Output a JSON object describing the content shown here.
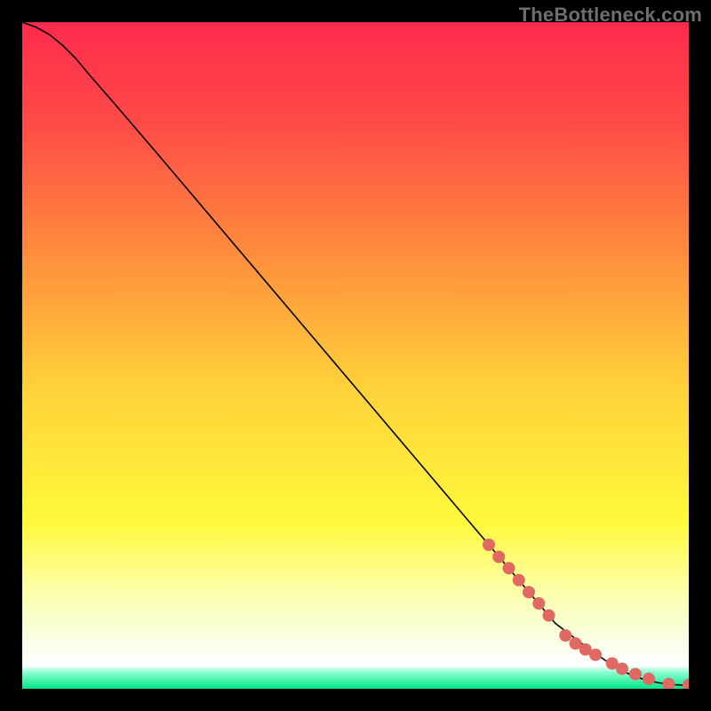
{
  "watermark": "TheBottleneck.com",
  "chart_data": {
    "type": "line",
    "title": "",
    "xlabel": "",
    "ylabel": "",
    "xlim": [
      0,
      100
    ],
    "ylim": [
      0,
      100
    ],
    "grid": false,
    "legend": false,
    "background_gradient": {
      "stops": [
        {
          "offset": 0.0,
          "color": "#ff2b4d"
        },
        {
          "offset": 0.15,
          "color": "#ff4a47"
        },
        {
          "offset": 0.35,
          "color": "#ff8e3d"
        },
        {
          "offset": 0.55,
          "color": "#ffd23a"
        },
        {
          "offset": 0.75,
          "color": "#fff93b"
        },
        {
          "offset": 0.85,
          "color": "#fdffa6"
        },
        {
          "offset": 0.92,
          "color": "#f7ffe0"
        },
        {
          "offset": 0.965,
          "color": "#ffffff"
        },
        {
          "offset": 0.975,
          "color": "#8dffd1"
        },
        {
          "offset": 1.0,
          "color": "#00e587"
        }
      ]
    },
    "series": [
      {
        "name": "curve",
        "type": "line",
        "color": "#000000",
        "x": [
          0,
          2,
          4,
          6,
          8,
          10,
          14,
          20,
          30,
          40,
          50,
          60,
          70,
          80,
          85,
          88,
          90,
          92,
          94,
          95.5,
          97,
          98,
          99,
          100
        ],
        "y": [
          100,
          99.3,
          98.2,
          96.6,
          94.6,
          92.2,
          87.6,
          80.6,
          68.8,
          57.0,
          45.2,
          33.4,
          21.6,
          9.8,
          6.0,
          3.9,
          2.7,
          1.8,
          1.2,
          0.9,
          0.7,
          0.6,
          0.55,
          0.55
        ]
      },
      {
        "name": "highlighted-points",
        "type": "scatter",
        "color": "#e06a63",
        "radius": 7,
        "x": [
          70.0,
          71.5,
          73.0,
          74.5,
          76.0,
          77.5,
          79.0,
          81.5,
          83.0,
          84.5,
          86.0,
          88.5,
          90.0,
          92.0,
          94.0,
          97.0,
          100.0
        ],
        "y": [
          21.6,
          19.8,
          18.1,
          16.3,
          14.5,
          12.8,
          11.0,
          8.0,
          6.8,
          5.9,
          5.1,
          3.8,
          3.0,
          2.2,
          1.5,
          0.7,
          0.55
        ]
      }
    ]
  }
}
